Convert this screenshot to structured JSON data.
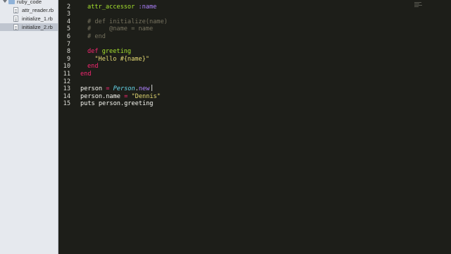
{
  "sidebar": {
    "folder": "ruby_code",
    "files": [
      "attr_reader.rb",
      "initialize_1.rb",
      "initialize_2.rb"
    ],
    "selected": "initialize_2.rb"
  },
  "editor": {
    "colors": {
      "background": "#1d1e19",
      "keyword": "#f92672",
      "function": "#a6e22e",
      "symbol": "#ae81ff",
      "class": "#66d9ef",
      "string": "#e6db74",
      "comment": "#75715e",
      "text": "#f8f8f2"
    },
    "lines": [
      {
        "n": "2",
        "t": [
          [
            "attr_accessor",
            "fn"
          ],
          [
            " ",
            "plain"
          ],
          [
            ":name",
            "sym"
          ]
        ]
      },
      {
        "n": "3",
        "t": []
      },
      {
        "n": "4",
        "t": [
          [
            "# def initialize(name)",
            "cmt"
          ]
        ]
      },
      {
        "n": "5",
        "t": [
          [
            "#     @name = name",
            "cmt"
          ]
        ]
      },
      {
        "n": "6",
        "t": [
          [
            "# end",
            "cmt"
          ]
        ]
      },
      {
        "n": "7",
        "t": []
      },
      {
        "n": "8",
        "t": [
          [
            "def ",
            "kw"
          ],
          [
            "greeting",
            "fn"
          ]
        ]
      },
      {
        "n": "9",
        "t": [
          [
            "  \"Hello #{name}\"",
            "str"
          ]
        ]
      },
      {
        "n": "10",
        "t": [
          [
            "end",
            "kw"
          ]
        ]
      },
      {
        "n": "11",
        "t": [
          [
            "end",
            "kw"
          ]
        ]
      },
      {
        "n": "12",
        "t": []
      },
      {
        "n": "13",
        "t": [
          [
            "person ",
            "plain"
          ],
          [
            "=",
            "kw"
          ],
          [
            " ",
            "plain"
          ],
          [
            "Person",
            "cls"
          ],
          [
            ".",
            "plain"
          ],
          [
            "new",
            "sym"
          ]
        ]
      },
      {
        "n": "14",
        "t": [
          [
            "person.name ",
            "plain"
          ],
          [
            "=",
            "kw"
          ],
          [
            " ",
            "plain"
          ],
          [
            "\"Dennis\"",
            "str"
          ]
        ]
      },
      {
        "n": "15",
        "t": [
          [
            "puts person.greeting",
            "plain"
          ]
        ]
      }
    ]
  }
}
